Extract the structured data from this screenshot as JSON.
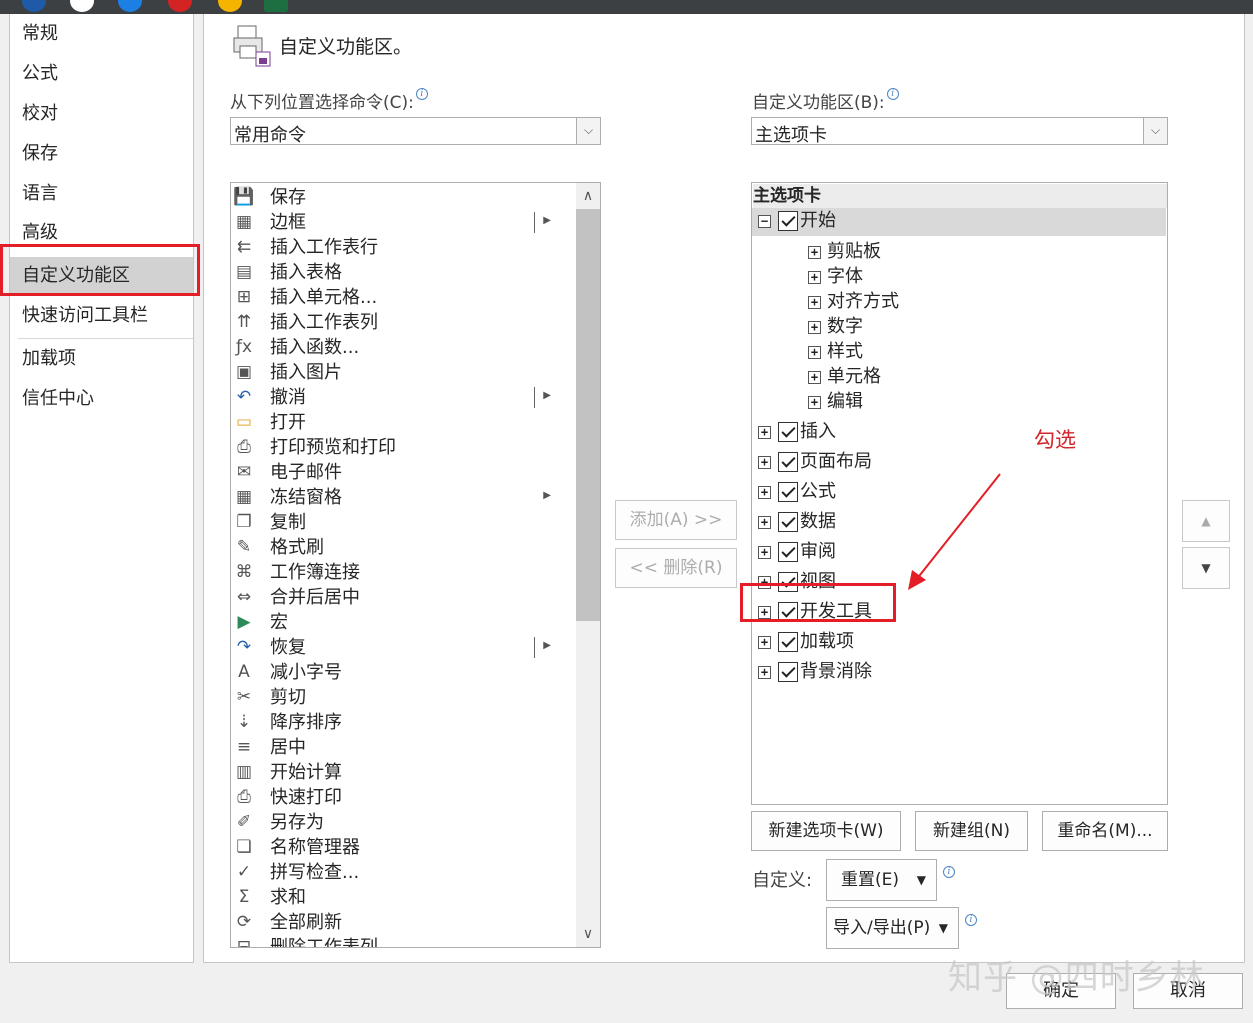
{
  "nav": {
    "items": [
      "常规",
      "公式",
      "校对",
      "保存",
      "语言",
      "高级",
      "自定义功能区",
      "快速访问工具栏",
      "加载项",
      "信任中心"
    ],
    "selected": "自定义功能区"
  },
  "header": {
    "title": "自定义功能区。"
  },
  "left": {
    "label": "从下列位置选择命令(C):",
    "combo_value": "常用命令",
    "commands": [
      {
        "label": "保存",
        "icon": "save-icon"
      },
      {
        "label": "边框",
        "icon": "border-icon",
        "submenu": true
      },
      {
        "label": "插入工作表行",
        "icon": "insert-row-icon"
      },
      {
        "label": "插入表格",
        "icon": "table-icon"
      },
      {
        "label": "插入单元格...",
        "icon": "insert-cell-icon"
      },
      {
        "label": "插入工作表列",
        "icon": "insert-column-icon"
      },
      {
        "label": "插入函数...",
        "icon": "function-icon"
      },
      {
        "label": "插入图片",
        "icon": "picture-icon"
      },
      {
        "label": "撤消",
        "icon": "undo-icon",
        "submenu": true
      },
      {
        "label": "打开",
        "icon": "folder-icon"
      },
      {
        "label": "打印预览和打印",
        "icon": "print-preview-icon"
      },
      {
        "label": "电子邮件",
        "icon": "email-icon"
      },
      {
        "label": "冻结窗格",
        "icon": "freeze-panes-icon",
        "submenu": true
      },
      {
        "label": "复制",
        "icon": "copy-icon"
      },
      {
        "label": "格式刷",
        "icon": "format-painter-icon"
      },
      {
        "label": "工作簿连接",
        "icon": "connection-icon"
      },
      {
        "label": "合并后居中",
        "icon": "merge-center-icon"
      },
      {
        "label": "宏",
        "icon": "macro-icon"
      },
      {
        "label": "恢复",
        "icon": "redo-icon",
        "submenu": true
      },
      {
        "label": "减小字号",
        "icon": "font-decrease-icon"
      },
      {
        "label": "剪切",
        "icon": "cut-icon"
      },
      {
        "label": "降序排序",
        "icon": "sort-desc-icon"
      },
      {
        "label": "居中",
        "icon": "align-center-icon"
      },
      {
        "label": "开始计算",
        "icon": "calculator-icon"
      },
      {
        "label": "快速打印",
        "icon": "quick-print-icon"
      },
      {
        "label": "另存为",
        "icon": "save-as-icon"
      },
      {
        "label": "名称管理器",
        "icon": "name-manager-icon"
      },
      {
        "label": "拼写检查...",
        "icon": "spelling-icon"
      },
      {
        "label": "求和",
        "icon": "sum-icon"
      },
      {
        "label": "全部刷新",
        "icon": "refresh-icon"
      },
      {
        "label": "删除工作表列",
        "icon": "delete-column-icon"
      }
    ]
  },
  "middle": {
    "add_label": "添加(A) >>",
    "remove_label": "<< 删除(R)"
  },
  "right": {
    "label": "自定义功能区(B):",
    "combo_value": "主选项卡",
    "tree_header": "主选项卡",
    "tabs": [
      {
        "label": "开始",
        "expanded": true,
        "checked": true,
        "groups": [
          "剪贴板",
          "字体",
          "对齐方式",
          "数字",
          "样式",
          "单元格",
          "编辑"
        ]
      },
      {
        "label": "插入",
        "checked": true
      },
      {
        "label": "页面布局",
        "checked": true
      },
      {
        "label": "公式",
        "checked": true
      },
      {
        "label": "数据",
        "checked": true
      },
      {
        "label": "审阅",
        "checked": true
      },
      {
        "label": "视图",
        "checked": true
      },
      {
        "label": "开发工具",
        "checked": true
      },
      {
        "label": "加载项",
        "checked": true
      },
      {
        "label": "背景消除",
        "checked": true
      }
    ],
    "new_tab": "新建选项卡(W)",
    "new_group": "新建组(N)",
    "rename": "重命名(M)...",
    "customize_label": "自定义:",
    "reset": "重置(E)",
    "import_export": "导入/导出(P)"
  },
  "annotation": {
    "text": "勾选",
    "color": "#d0262c"
  },
  "footer": {
    "ok": "确定",
    "cancel": "取消"
  },
  "watermark": "知乎 @四时乡林",
  "colors": {
    "highlight_red": "#e41e26",
    "selected_nav": "#d2d2d2"
  }
}
